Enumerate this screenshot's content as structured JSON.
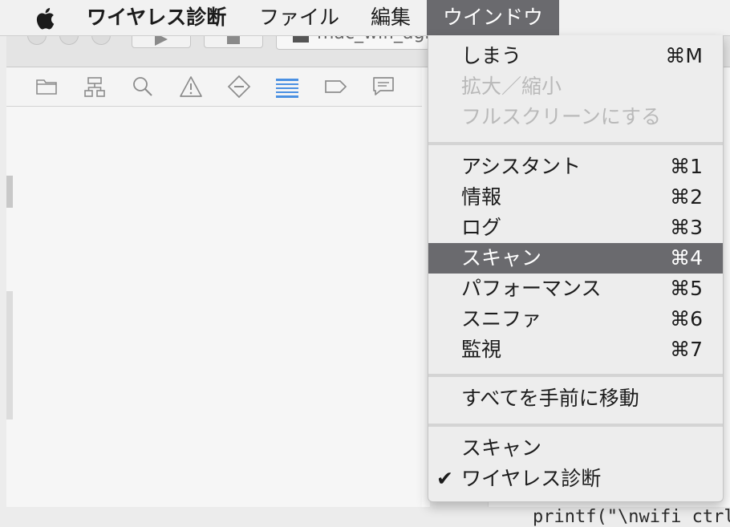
{
  "menubar": {
    "app_name": "ワイヤレス診断",
    "items": [
      {
        "label": "ファイル"
      },
      {
        "label": "編集"
      },
      {
        "label": "ウインドウ"
      }
    ]
  },
  "toolbar": {
    "scheme_text": "mac_wifi_agr"
  },
  "nav_icons": [
    "folder-icon",
    "hierarchy-icon",
    "search-icon",
    "warning-icon",
    "breakpoint-icon",
    "list-icon",
    "tag-icon",
    "comment-icon"
  ],
  "colors": {
    "highlight": "#6a6a6e",
    "disabled_text": "#b9b9b9",
    "nav_selected": "#2f7ed8"
  },
  "window_menu": {
    "items": [
      {
        "label": "しまう",
        "shortcut": "⌘M"
      },
      {
        "label": "拡大／縮小",
        "shortcut": ""
      },
      {
        "label": "フルスクリーンにする",
        "shortcut": ""
      },
      {
        "label": "アシスタント",
        "shortcut": "⌘1"
      },
      {
        "label": "情報",
        "shortcut": "⌘2"
      },
      {
        "label": "ログ",
        "shortcut": "⌘3"
      },
      {
        "label": "スキャン",
        "shortcut": "⌘4"
      },
      {
        "label": "パフォーマンス",
        "shortcut": "⌘5"
      },
      {
        "label": "スニファ",
        "shortcut": "⌘6"
      },
      {
        "label": "監視",
        "shortcut": "⌘7"
      },
      {
        "label": "すべてを手前に移動",
        "shortcut": ""
      },
      {
        "label": "スキャン",
        "shortcut": ""
      },
      {
        "label": "ワイヤレス診断",
        "shortcut": "",
        "checkmark": "✔"
      }
    ],
    "highlighted_item": "スキャン",
    "disabled_items": [
      "拡大／縮小",
      "フルスクリーンにする"
    ]
  },
  "code": {
    "fragment_1": "printf(\"\\nwifi ctrl"
  }
}
